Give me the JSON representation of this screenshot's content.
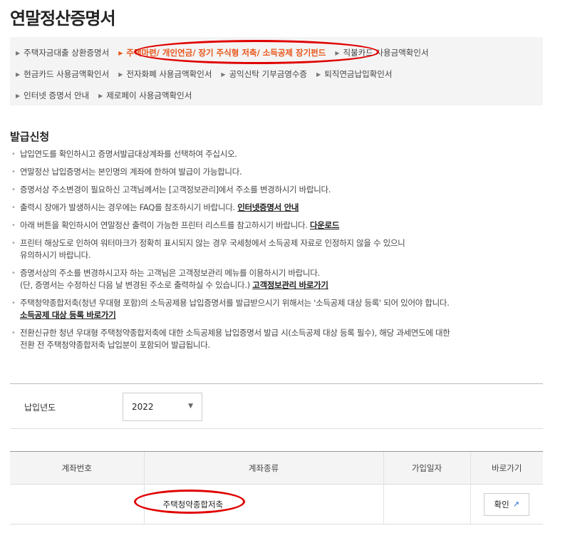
{
  "page": {
    "title": "연말정산증명서"
  },
  "tabs": {
    "row1": [
      {
        "label": "주택자금대출 상환증명서",
        "active": false
      },
      {
        "label": "주택마련/ 개인연금/ 장기 주식형 저축/ 소득공제 장기펀드",
        "active": true
      },
      {
        "label": "직불카드 사용금액확인서",
        "active": false
      }
    ],
    "row2": [
      {
        "label": "현금카드 사용금액확인서",
        "active": false
      },
      {
        "label": "전자화폐 사용금액확인서",
        "active": false
      },
      {
        "label": "공익신탁 기부금영수증",
        "active": false
      },
      {
        "label": "퇴직연금납입확인서",
        "active": false
      }
    ],
    "row3": [
      {
        "label": "인터넷 증명서 안내",
        "active": false
      },
      {
        "label": "제로페이 사용금액확인서",
        "active": false
      }
    ]
  },
  "issue": {
    "title": "발급신청",
    "notes": [
      {
        "text": "납입연도를 확인하시고 증명서발급대상계좌를 선택하여 주십시오."
      },
      {
        "text": "연말정산 납입증명서는 본인명의 계좌에 한하여 발급이 가능합니다."
      },
      {
        "text": "증명서상 주소변경이 필요하신 고객님께서는 [고객정보관리]에서 주소를 변경하시기 바랍니다."
      },
      {
        "text": "출력시 장애가 발생하시는 경우에는 FAQ를 참조하시기 바랍니다. ",
        "link": "인터넷증명서 안내"
      },
      {
        "text": "아래 버튼을 확인하시어 연말정산 출력이 가능한 프린터 리스트를 참고하시기 바랍니다. ",
        "link": "다운로드"
      },
      {
        "text": "프린터 해상도로 인하여 워터마크가 정확히 표시되지 않는 경우 국세청에서 소득공제 자료로 인정하지 않을 수 있으니",
        "text2": "유의하시기 바랍니다."
      },
      {
        "text": "증명서상의 주소를 변경하시고자 하는 고객님은 고객정보관리 메뉴를 이용하시기 바랍니다.",
        "text2": "(단, 증명서는 수정하신 다음 날 변경된 주소로 출력하실 수 있습니다.) ",
        "link": "고객정보관리 바로가기"
      },
      {
        "text": "주택청약종합저축(청년 우대형 포함)의 소득공제용 납입증명서를 발급받으시기 위해서는 '소득공제 대상 등록' 되어 있어야 합니다.",
        "link": "소득공제 대상 등록 바로가기"
      },
      {
        "text": "전환신규한 청년 우대형 주택청약종합저축에 대한 소득공제용 납입증명서 발급 시(소득공제 대상 등록 필수), 해당 과세연도에 대한",
        "text2": "전환 전 주택청약종합저축 납입분이 포함되어 발급됩니다."
      }
    ]
  },
  "year": {
    "label": "납입년도",
    "value": "2022"
  },
  "table": {
    "headers": [
      "계좌번호",
      "계좌종류",
      "가입일자",
      "바로가기"
    ],
    "rows": [
      {
        "account_no": "",
        "type": "주택청약종합저축",
        "joined": "",
        "action": "확인"
      }
    ]
  },
  "icons": {
    "tab_bullet": "triangle-right-icon",
    "select_caret": "caret-down-icon",
    "external_link": "external-link-icon"
  },
  "colors": {
    "accent": "#e8551a",
    "annotation_ring": "#e00000",
    "panel_bg": "#f4f4f4",
    "link_blue": "#2a6bd6"
  }
}
